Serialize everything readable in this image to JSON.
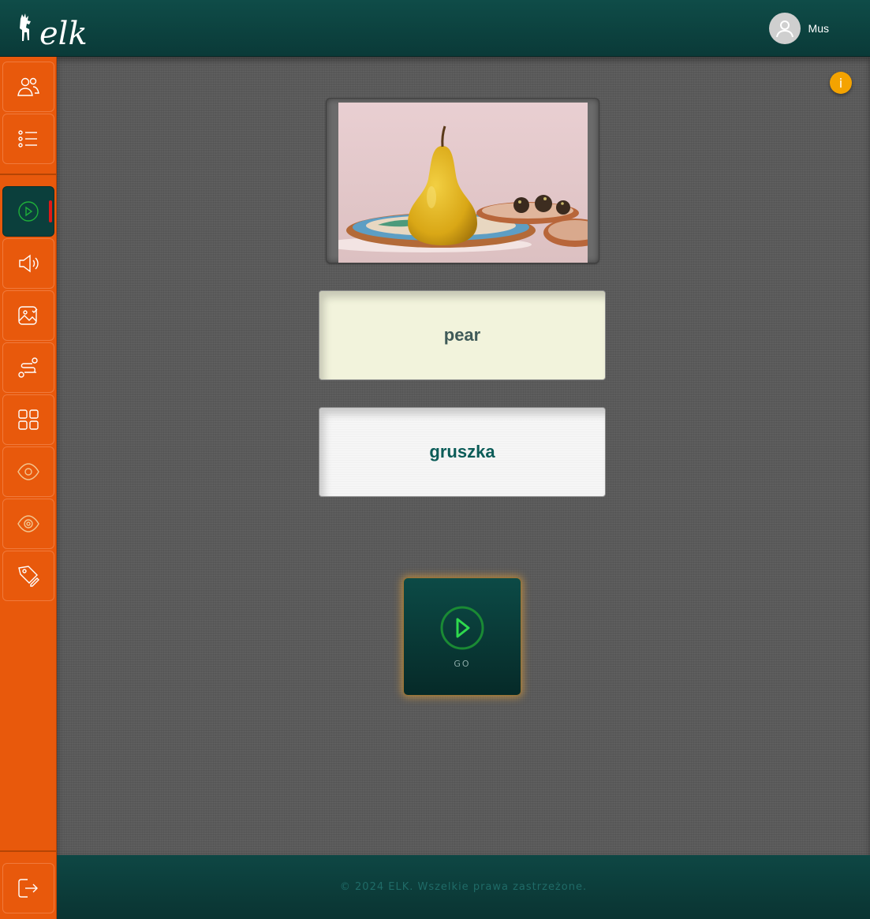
{
  "app": {
    "logo_text": "elk",
    "user_name": "Mus"
  },
  "sidebar": {
    "items": [
      {
        "name": "users-icon"
      },
      {
        "name": "list-icon"
      },
      {
        "name": "play-icon",
        "active": true
      },
      {
        "name": "speaker-icon"
      },
      {
        "name": "image-check-icon"
      },
      {
        "name": "route-icon"
      },
      {
        "name": "grid-icon"
      },
      {
        "name": "eye-icon"
      },
      {
        "name": "eye-target-icon"
      },
      {
        "name": "tag-edit-icon"
      }
    ],
    "logout_icon": "logout-icon"
  },
  "main": {
    "info_label": "i",
    "image_alt": "pear on a plate",
    "word_english": "pear",
    "word_translation": "gruszka",
    "go_label": "GO"
  },
  "footer": {
    "copyright": "© 2024 ELK. Wszelkie prawa zastrzeżone."
  },
  "colors": {
    "accent_orange": "#e8590c",
    "dark_teal": "#0b3f3c",
    "go_green": "#1fae3a",
    "info_yellow": "#f4a300"
  }
}
